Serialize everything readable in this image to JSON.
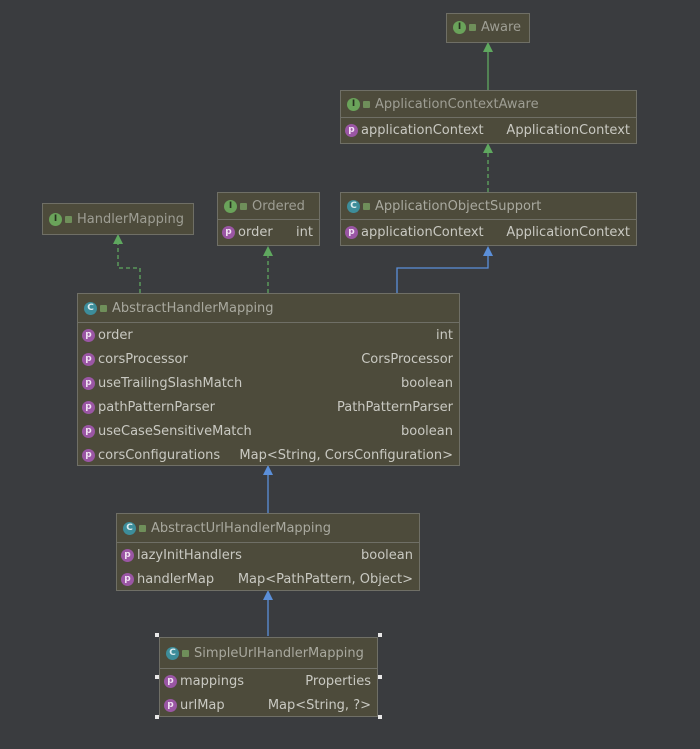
{
  "nodes": {
    "aware": {
      "kind": "i",
      "title": "Aware",
      "fields": []
    },
    "application_context_aware": {
      "kind": "i",
      "title": "ApplicationContextAware",
      "fields": [
        {
          "name": "applicationContext",
          "type": "ApplicationContext"
        }
      ]
    },
    "handler_mapping": {
      "kind": "i",
      "title": "HandlerMapping",
      "fields": []
    },
    "ordered": {
      "kind": "i",
      "title": "Ordered",
      "fields": [
        {
          "name": "order",
          "type": "int"
        }
      ]
    },
    "application_object_support": {
      "kind": "c",
      "title": "ApplicationObjectSupport",
      "fields": [
        {
          "name": "applicationContext",
          "type": "ApplicationContext"
        }
      ]
    },
    "abstract_handler_mapping": {
      "kind": "c",
      "title": "AbstractHandlerMapping",
      "fields": [
        {
          "name": "order",
          "type": "int"
        },
        {
          "name": "corsProcessor",
          "type": "CorsProcessor"
        },
        {
          "name": "useTrailingSlashMatch",
          "type": "boolean"
        },
        {
          "name": "pathPatternParser",
          "type": "PathPatternParser"
        },
        {
          "name": "useCaseSensitiveMatch",
          "type": "boolean"
        },
        {
          "name": "corsConfigurations",
          "type": "Map<String, CorsConfiguration>"
        }
      ]
    },
    "abstract_url_handler_mapping": {
      "kind": "c",
      "title": "AbstractUrlHandlerMapping",
      "fields": [
        {
          "name": "lazyInitHandlers",
          "type": "boolean"
        },
        {
          "name": "handlerMap",
          "type": "Map<PathPattern, Object>"
        }
      ]
    },
    "simple_url_handler_mapping": {
      "kind": "c",
      "title": "SimpleUrlHandlerMapping",
      "fields": [
        {
          "name": "mappings",
          "type": "Properties"
        },
        {
          "name": "urlMap",
          "type": "Map<String, ?>"
        }
      ]
    }
  },
  "badges": {
    "interface": "I",
    "class": "C",
    "property": "p"
  },
  "colors": {
    "background": "#3a3c3f",
    "node_fill": "#4d4b3b",
    "implements_edge": "#5fa85f",
    "extends_edge": "#5b8fd9"
  }
}
